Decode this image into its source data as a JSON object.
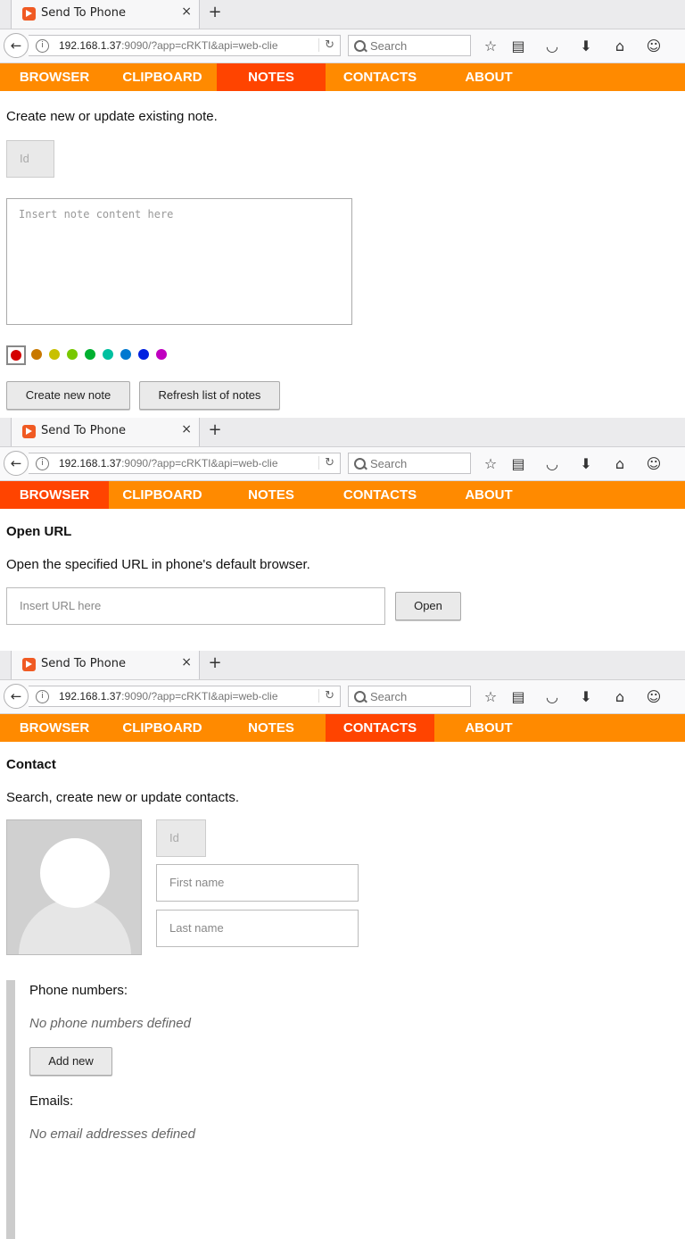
{
  "browser": {
    "tab_title": "Send To Phone",
    "tab_close": "×",
    "new_tab": "+",
    "url_host": "192.168.1.37",
    "url_rest": ":9090/?app=cRKTI&api=web-clie",
    "search_placeholder": "Search"
  },
  "menu": [
    "BROWSER",
    "CLIPBOARD",
    "NOTES",
    "CONTACTS",
    "ABOUT"
  ],
  "notes": {
    "active_tab": "NOTES",
    "description": "Create new or update existing note.",
    "id_placeholder": "Id",
    "content_placeholder": "Insert note content here",
    "colors": [
      "#d40000",
      "#c87800",
      "#c8c000",
      "#78c800",
      "#00b030",
      "#00c0a0",
      "#0078d0",
      "#0020e0",
      "#c000c0"
    ],
    "selected_color_index": 0,
    "create_button": "Create new note",
    "refresh_button": "Refresh list of notes"
  },
  "browser_page": {
    "active_tab": "BROWSER",
    "title": "Open URL",
    "description": "Open the specified URL in phone's default browser.",
    "url_placeholder": "Insert URL here",
    "open_button": "Open"
  },
  "contacts": {
    "active_tab": "CONTACTS",
    "title": "Contact",
    "description": "Search, create new or update contacts.",
    "id_placeholder": "Id",
    "first_name_placeholder": "First name",
    "last_name_placeholder": "Last name",
    "phone_label": "Phone numbers:",
    "phone_empty": "No phone numbers defined",
    "add_new_button": "Add new",
    "email_label": "Emails:",
    "email_empty": "No email addresses defined"
  },
  "colors": {
    "menu_bg": "#ff8a00",
    "menu_active": "#ff4400"
  }
}
